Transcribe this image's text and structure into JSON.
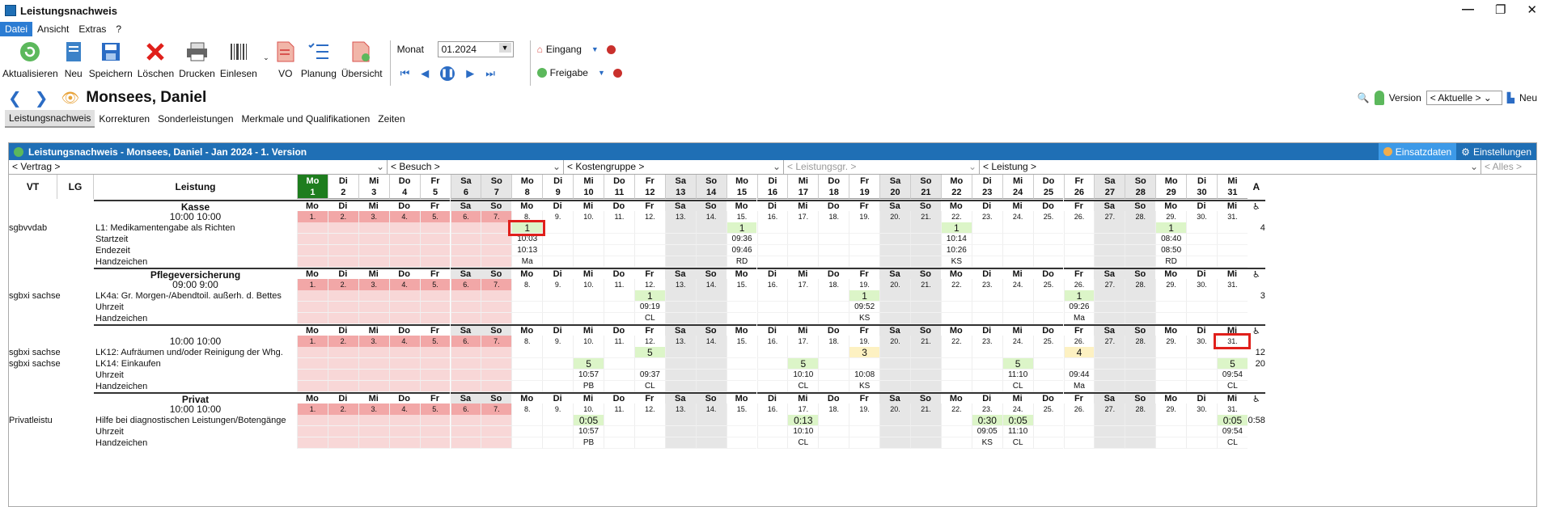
{
  "window": {
    "title": "Leistungsnachweis",
    "controls": [
      "—",
      "❐",
      "✕"
    ]
  },
  "menu": [
    "Datei",
    "Ansicht",
    "Extras",
    "?"
  ],
  "toolbar": {
    "buttons": [
      "Aktualisieren",
      "Neu",
      "Speichern",
      "Löschen",
      "Drucken",
      "Einlesen",
      "VO",
      "Planung",
      "Übersicht"
    ],
    "month_label": "Monat",
    "month_value": "01.2024",
    "eingang": "Eingang",
    "freigabe": "Freigabe"
  },
  "nav": {
    "patient": "Monsees, Daniel",
    "version_label": "Version",
    "version_value": "< Aktuelle >",
    "new_label": "Neu"
  },
  "tabs": [
    "Leistungsnachweis",
    "Korrekturen",
    "Sonderleistungen",
    "Merkmale und Qualifikationen",
    "Zeiten"
  ],
  "panel": {
    "title": "Leistungsnachweis - Monsees, Daniel - Jan 2024 - 1. Version",
    "einsatzdaten": "Einsatzdaten",
    "einstellungen": "Einstellungen"
  },
  "filters": [
    "< Vertrag >",
    "< Besuch >",
    "< Kostengruppe >",
    "< Leistungsgr. >",
    "< Leistung >",
    "< Alles >"
  ],
  "columns": {
    "vt": "VT",
    "lg": "LG",
    "leistung": "Leistung",
    "a": "A"
  },
  "days": [
    "Mo",
    "Di",
    "Mi",
    "Do",
    "Fr",
    "Sa",
    "So",
    "Mo",
    "Di",
    "Mi",
    "Do",
    "Fr",
    "Sa",
    "So",
    "Mo",
    "Di",
    "Mi",
    "Do",
    "Fr",
    "Sa",
    "So",
    "Mo",
    "Di",
    "Mi",
    "Do",
    "Fr",
    "Sa",
    "So",
    "Mo",
    "Di",
    "Mi"
  ],
  "sections": [
    {
      "name": "Kasse",
      "time": "10:00 10:00",
      "rows": [
        {
          "vt": "sgbvvdab",
          "label": "L1: Medikamentengabe als Richten",
          "vals": {
            "8": "1",
            "15": "1",
            "22": "1",
            "29": "1"
          },
          "a": "4"
        },
        {
          "label": "Startzeit",
          "vals": {
            "8": "10:03",
            "15": "09:36",
            "22": "10:14",
            "29": "08:40"
          }
        },
        {
          "label": "Endezeit",
          "vals": {
            "8": "10:13",
            "15": "09:46",
            "22": "10:26",
            "29": "08:50"
          }
        },
        {
          "label": "Handzeichen",
          "vals": {
            "8": "Ma",
            "15": "RD",
            "22": "KS",
            "29": "RD"
          }
        }
      ]
    },
    {
      "name": "Pflegeversicherung",
      "time": "09:00 9:00",
      "rows": [
        {
          "vt": "sgbxi sachse",
          "label": "LK4a: Gr. Morgen-/Abendtoil. außerh. d. Bettes",
          "vals": {
            "12": "1",
            "19": "1",
            "26": "1"
          },
          "a": "3"
        },
        {
          "label": "Uhrzeit",
          "vals": {
            "12": "09:19",
            "19": "09:52",
            "26": "09:26"
          }
        },
        {
          "label": "Handzeichen",
          "vals": {
            "12": "CL",
            "19": "KS",
            "26": "Ma"
          }
        }
      ]
    },
    {
      "name": "",
      "time": "10:00 10:00",
      "rows": [
        {
          "vt": "sgbxi sachse",
          "label": "LK12: Aufräumen und/oder Reinigung der Whg.",
          "vals": {
            "12": "5",
            "19": "3",
            "26": "4"
          },
          "a": "12"
        },
        {
          "vt": "sgbxi sachse",
          "label": "LK14: Einkaufen",
          "vals": {
            "10": "5",
            "17": "5",
            "24": "5",
            "31": "5"
          },
          "a": "20"
        },
        {
          "label": "Uhrzeit",
          "vals": {
            "10": "10:57",
            "12": "09:37",
            "17": "10:10",
            "19": "10:08",
            "24": "11:10",
            "26": "09:44",
            "31": "09:54"
          }
        },
        {
          "label": "Handzeichen",
          "vals": {
            "10": "PB",
            "12": "CL",
            "17": "CL",
            "19": "KS",
            "24": "CL",
            "26": "Ma",
            "31": "CL"
          }
        }
      ]
    },
    {
      "name": "Privat",
      "time": "10:00 10:00",
      "rows": [
        {
          "vt": "Privatleistu",
          "label": "Hilfe bei diagnostischen Leistungen/Botengänge",
          "vals": {
            "10": "0:05",
            "17": "0:13",
            "23": "0:30",
            "24": "0:05",
            "31": "0:05"
          },
          "a": "0:58"
        },
        {
          "label": "Uhrzeit",
          "vals": {
            "10": "10:57",
            "17": "10:10",
            "23": "09:05",
            "24": "11:10",
            "31": "09:54"
          }
        },
        {
          "label": "Handzeichen",
          "vals": {
            "10": "PB",
            "17": "CL",
            "23": "KS",
            "24": "CL",
            "31": "CL"
          }
        }
      ]
    }
  ],
  "colors": {
    "accent": "#1f6fb5",
    "weekend": "#e6e6e6",
    "vacation": "#f8d7d7",
    "vacation_head": "#f2a7a7",
    "value_green": "#dcf5c8",
    "value_yellow": "#fdf1c2",
    "highlight": "#e0201b"
  }
}
